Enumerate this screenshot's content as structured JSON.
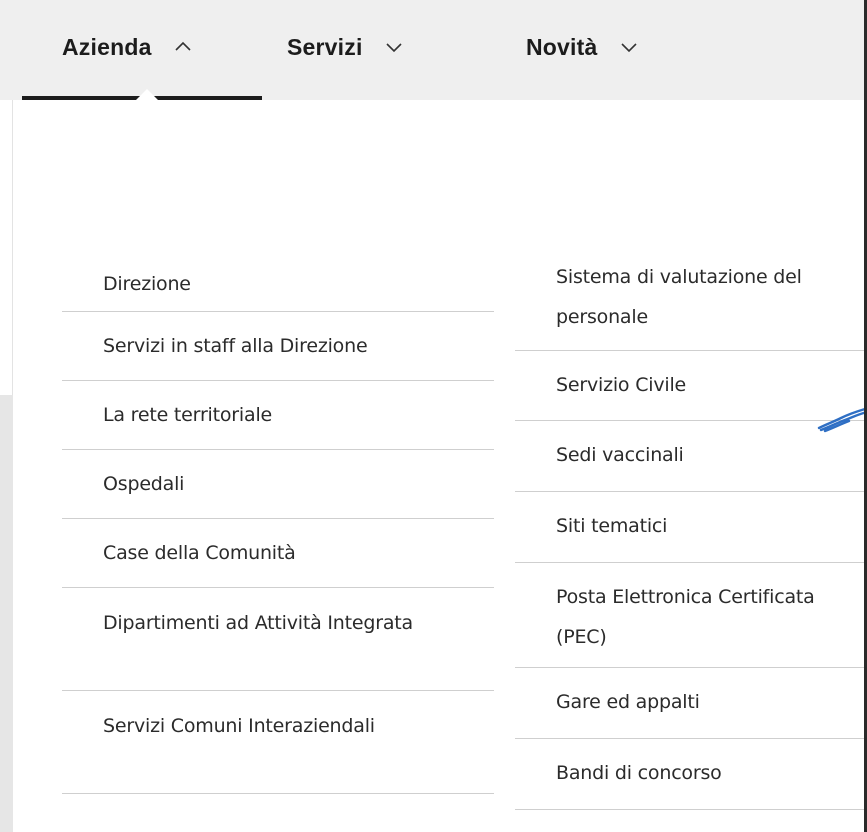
{
  "nav": {
    "items": [
      {
        "label": "Azienda",
        "chevron": "chevron-up-icon",
        "expanded": true
      },
      {
        "label": "Servizi",
        "chevron": "chevron-down-icon",
        "expanded": false
      },
      {
        "label": "Novità",
        "chevron": "chevron-down-icon",
        "expanded": false
      }
    ]
  },
  "dropdown": {
    "left_column": [
      "Direzione",
      "Servizi in staff alla Direzione",
      "La rete territoriale",
      "Ospedali",
      "Case della Comunità",
      "Dipartimenti ad Attività Integrata",
      "Servizi Comuni Interaziendali"
    ],
    "right_column": [
      "Sistema di valutazione del personale",
      "Servizio Civile",
      "Sedi vaccinali",
      "Siti tematici",
      "Posta Elettronica Certificata (PEC)",
      "Gare ed appalti",
      "Bandi di concorso"
    ]
  },
  "colors": {
    "nav_background": "#efefef",
    "text": "#2b2b2b",
    "divider": "#cfcfcf",
    "active_underline": "#1c1c1c",
    "scribble": "#2f6fc4"
  }
}
